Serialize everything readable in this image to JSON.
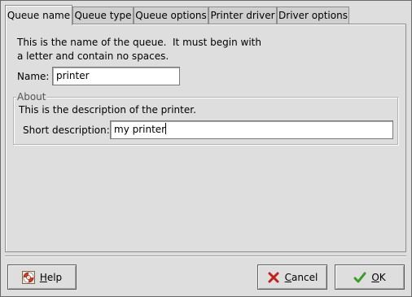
{
  "tabs": [
    {
      "label": "Queue name",
      "active": true
    },
    {
      "label": "Queue type",
      "active": false
    },
    {
      "label": "Queue options",
      "active": false
    },
    {
      "label": "Printer driver",
      "active": false
    },
    {
      "label": "Driver options",
      "active": false
    }
  ],
  "queue_name": {
    "intro_line1": "This is the name of the queue.  It must begin with",
    "intro_line2": "a letter and contain no spaces.",
    "name_label": "Name:",
    "name_value": "printer"
  },
  "about": {
    "legend": "About",
    "text": "This is the description of the printer.",
    "desc_label": "Short description:",
    "desc_value": "my printer"
  },
  "buttons": {
    "help_prefix": "",
    "help_mnemonic": "H",
    "help_rest": "elp",
    "cancel_mnemonic": "C",
    "cancel_rest": "ancel",
    "ok_mnemonic": "O",
    "ok_rest": "K"
  },
  "icons": {
    "help": "lifebuoy-icon",
    "cancel": "red-x-icon",
    "ok": "green-checkmark-icon"
  }
}
